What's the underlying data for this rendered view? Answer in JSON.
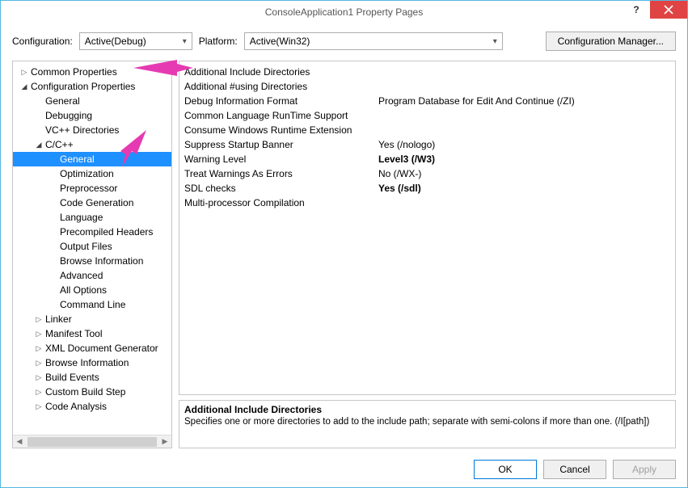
{
  "window": {
    "title": "ConsoleApplication1 Property Pages"
  },
  "toprow": {
    "config_label": "Configuration:",
    "config_value": "Active(Debug)",
    "platform_label": "Platform:",
    "platform_value": "Active(Win32)",
    "manager_button": "Configuration Manager..."
  },
  "tree": [
    {
      "label": "Common Properties",
      "indent": 0,
      "arrow": "right",
      "selected": false
    },
    {
      "label": "Configuration Properties",
      "indent": 0,
      "arrow": "down",
      "selected": false
    },
    {
      "label": "General",
      "indent": 1,
      "arrow": "",
      "selected": false
    },
    {
      "label": "Debugging",
      "indent": 1,
      "arrow": "",
      "selected": false
    },
    {
      "label": "VC++ Directories",
      "indent": 1,
      "arrow": "",
      "selected": false
    },
    {
      "label": "C/C++",
      "indent": 1,
      "arrow": "down",
      "selected": false
    },
    {
      "label": "General",
      "indent": 2,
      "arrow": "",
      "selected": true
    },
    {
      "label": "Optimization",
      "indent": 2,
      "arrow": "",
      "selected": false
    },
    {
      "label": "Preprocessor",
      "indent": 2,
      "arrow": "",
      "selected": false
    },
    {
      "label": "Code Generation",
      "indent": 2,
      "arrow": "",
      "selected": false
    },
    {
      "label": "Language",
      "indent": 2,
      "arrow": "",
      "selected": false
    },
    {
      "label": "Precompiled Headers",
      "indent": 2,
      "arrow": "",
      "selected": false
    },
    {
      "label": "Output Files",
      "indent": 2,
      "arrow": "",
      "selected": false
    },
    {
      "label": "Browse Information",
      "indent": 2,
      "arrow": "",
      "selected": false
    },
    {
      "label": "Advanced",
      "indent": 2,
      "arrow": "",
      "selected": false
    },
    {
      "label": "All Options",
      "indent": 2,
      "arrow": "",
      "selected": false
    },
    {
      "label": "Command Line",
      "indent": 2,
      "arrow": "",
      "selected": false
    },
    {
      "label": "Linker",
      "indent": 1,
      "arrow": "right",
      "selected": false
    },
    {
      "label": "Manifest Tool",
      "indent": 1,
      "arrow": "right",
      "selected": false
    },
    {
      "label": "XML Document Generator",
      "indent": 1,
      "arrow": "right",
      "selected": false
    },
    {
      "label": "Browse Information",
      "indent": 1,
      "arrow": "right",
      "selected": false
    },
    {
      "label": "Build Events",
      "indent": 1,
      "arrow": "right",
      "selected": false
    },
    {
      "label": "Custom Build Step",
      "indent": 1,
      "arrow": "right",
      "selected": false
    },
    {
      "label": "Code Analysis",
      "indent": 1,
      "arrow": "right",
      "selected": false
    }
  ],
  "props": [
    {
      "name": "Additional Include Directories",
      "value": "",
      "bold": false
    },
    {
      "name": "Additional #using Directories",
      "value": "",
      "bold": false
    },
    {
      "name": "Debug Information Format",
      "value": "Program Database for Edit And Continue (/ZI)",
      "bold": false
    },
    {
      "name": "Common Language RunTime Support",
      "value": "",
      "bold": false
    },
    {
      "name": "Consume Windows Runtime Extension",
      "value": "",
      "bold": false
    },
    {
      "name": "Suppress Startup Banner",
      "value": "Yes (/nologo)",
      "bold": false
    },
    {
      "name": "Warning Level",
      "value": "Level3 (/W3)",
      "bold": true
    },
    {
      "name": "Treat Warnings As Errors",
      "value": "No (/WX-)",
      "bold": false
    },
    {
      "name": "SDL checks",
      "value": "Yes (/sdl)",
      "bold": true
    },
    {
      "name": "Multi-processor Compilation",
      "value": "",
      "bold": false
    }
  ],
  "desc": {
    "title": "Additional Include Directories",
    "body": "Specifies one or more directories to add to the include path; separate with semi-colons if more than one. (/I[path])"
  },
  "footer": {
    "ok": "OK",
    "cancel": "Cancel",
    "apply": "Apply"
  }
}
